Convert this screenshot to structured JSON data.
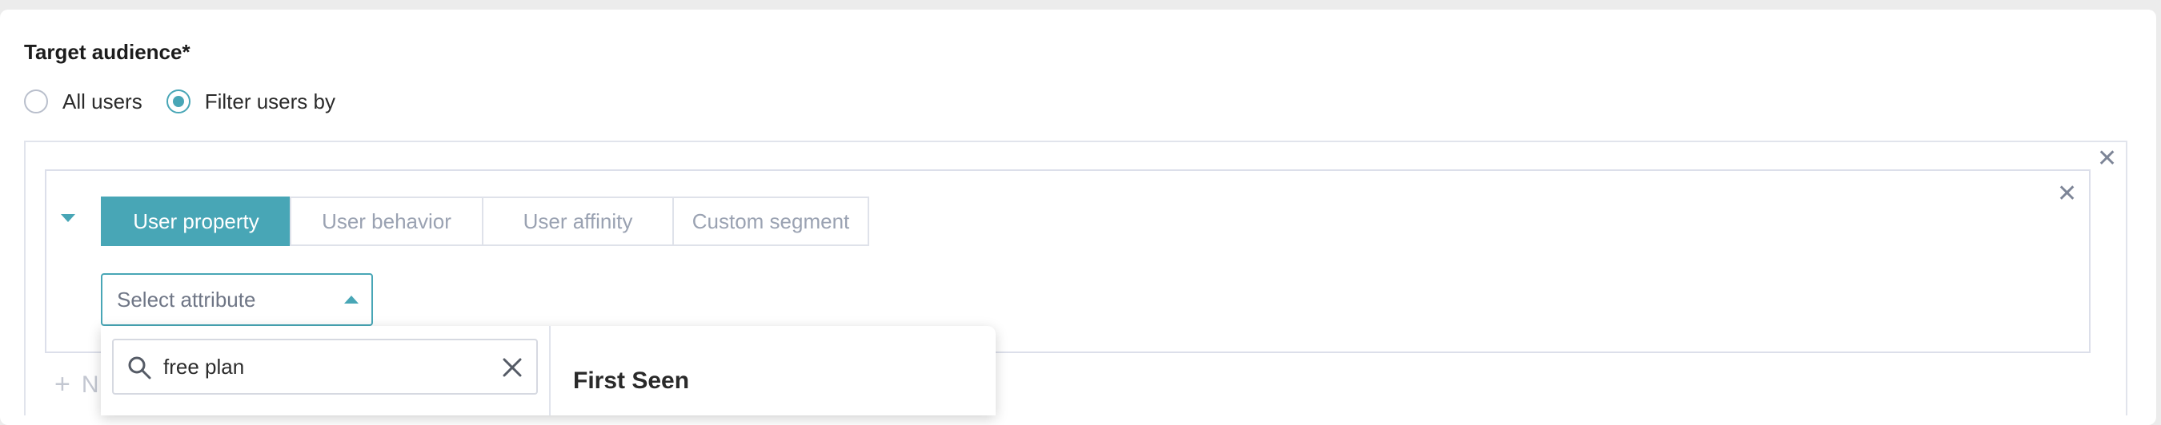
{
  "section": {
    "title": "Target audience*"
  },
  "audience_options": [
    {
      "label": "All users",
      "checked": false
    },
    {
      "label": "Filter users by",
      "checked": true
    }
  ],
  "filter_tabs": [
    {
      "label": "User property",
      "active": true
    },
    {
      "label": "User behavior",
      "active": false
    },
    {
      "label": "User affinity",
      "active": false
    },
    {
      "label": "Custom segment",
      "active": false
    }
  ],
  "attribute_select": {
    "placeholder": "Select attribute"
  },
  "dropdown": {
    "search_value": "free plan",
    "group_heading": "First Seen"
  },
  "add_filter": {
    "label_fragment": "N"
  },
  "colors": {
    "accent": "#48a6b6",
    "border": "#dfe2ea",
    "muted_text": "#9aa2b2"
  },
  "icons": {
    "close": "close-icon",
    "search": "search-icon",
    "clear": "clear-icon",
    "expand": "caret-down-icon",
    "select": "caret-up-icon",
    "add": "plus-icon"
  }
}
